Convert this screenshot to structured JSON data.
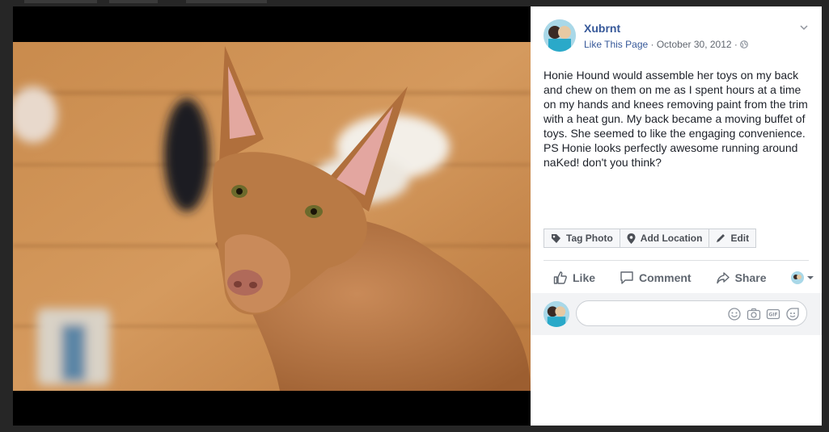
{
  "post": {
    "author": "Xubrnt",
    "like_page": "Like This Page",
    "separator": " · ",
    "date": "October 30, 2012",
    "caption": "Honie Hound would assemble her toys on my back and chew on them on me as I spent hours at a time on my hands and knees removing paint from the trim with a heat gun. My back became a moving buffet of toys. She seemed to like the engaging convenience. PS Honie looks perfectly awesome running around naKed! don't you think?"
  },
  "photo_actions": {
    "tag": "Tag Photo",
    "location": "Add Location",
    "edit": "Edit"
  },
  "ufi": {
    "like": "Like",
    "comment": "Comment",
    "share": "Share"
  },
  "comment": {
    "placeholder": ""
  },
  "icons": [
    "globe-icon",
    "chevron-down-icon",
    "tag-icon",
    "location-pin-icon",
    "pencil-icon",
    "thumbs-up-icon",
    "comment-icon",
    "share-icon",
    "emoji-icon",
    "camera-icon",
    "gif-icon",
    "sticker-icon"
  ],
  "colors": {
    "link": "#365899",
    "text": "#1d2129",
    "meta": "#616770",
    "border": "#ccd0d5"
  }
}
